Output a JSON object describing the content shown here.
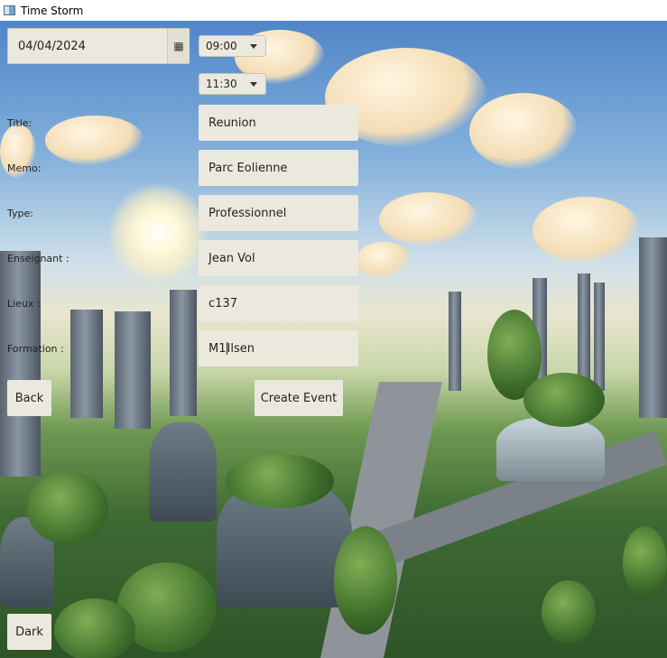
{
  "window": {
    "title": "Time Storm"
  },
  "date_picker": {
    "value": "04/04/2024",
    "icon": "calendar-icon"
  },
  "start_time": {
    "value": "09:00"
  },
  "end_time": {
    "value": "11:30"
  },
  "labels": {
    "title": "Title:",
    "memo": "Memo:",
    "type": "Type:",
    "teacher": "Enseignant :",
    "place": "Lieux :",
    "formation": "Formation :"
  },
  "fields": {
    "title": "Reunion",
    "memo": "Parc Eolienne",
    "type": "Professionnel",
    "teacher": "Jean Vol",
    "place": "c137",
    "formation_before_caret": "M1",
    "formation_after_caret": "Ilsen"
  },
  "buttons": {
    "back": "Back",
    "create_event": "Create Event",
    "dark": "Dark"
  }
}
